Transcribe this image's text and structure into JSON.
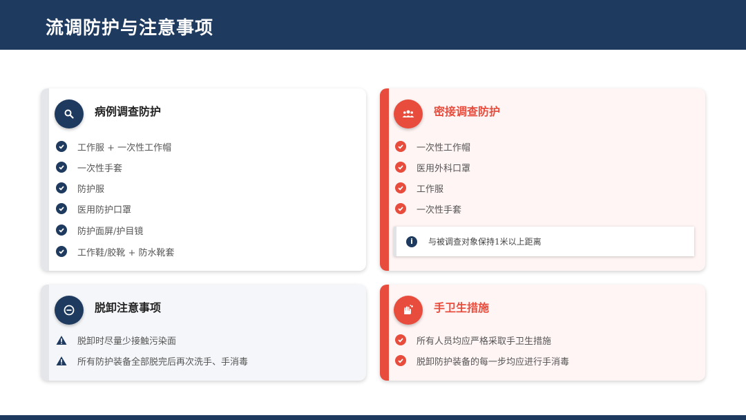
{
  "header": {
    "title": "流调防护与注意事项"
  },
  "colors": {
    "navy": "#1e3a5f",
    "red": "#e84c3d",
    "light_red_bg": "#fff5f4"
  },
  "cards": {
    "case_protection": {
      "title": "病例调查防护",
      "icon": "search-icon",
      "items": [
        "工作服 + 一次性工作帽",
        "一次性手套",
        "防护服",
        "医用防护口罩",
        "防护面屏/护目镜",
        "工作鞋/胶靴 + 防水靴套"
      ]
    },
    "contact_protection": {
      "title": "密接调查防护",
      "icon": "people-icon",
      "items": [
        "一次性工作帽",
        "医用外科口罩",
        "工作服",
        "一次性手套"
      ],
      "note": "与被调查对象保持1米以上距离"
    },
    "doffing": {
      "title": "脱卸注意事项",
      "icon": "minus-circle-icon",
      "items": [
        "脱卸时尽量少接触污染面",
        "所有防护装备全部脱完后再次洗手、手消毒"
      ]
    },
    "hand_hygiene": {
      "title": "手卫生措施",
      "icon": "hand-wash-icon",
      "items": [
        "所有人员均应严格采取手卫生措施",
        "脱卸防护装备的每一步均应进行手消毒"
      ]
    }
  }
}
